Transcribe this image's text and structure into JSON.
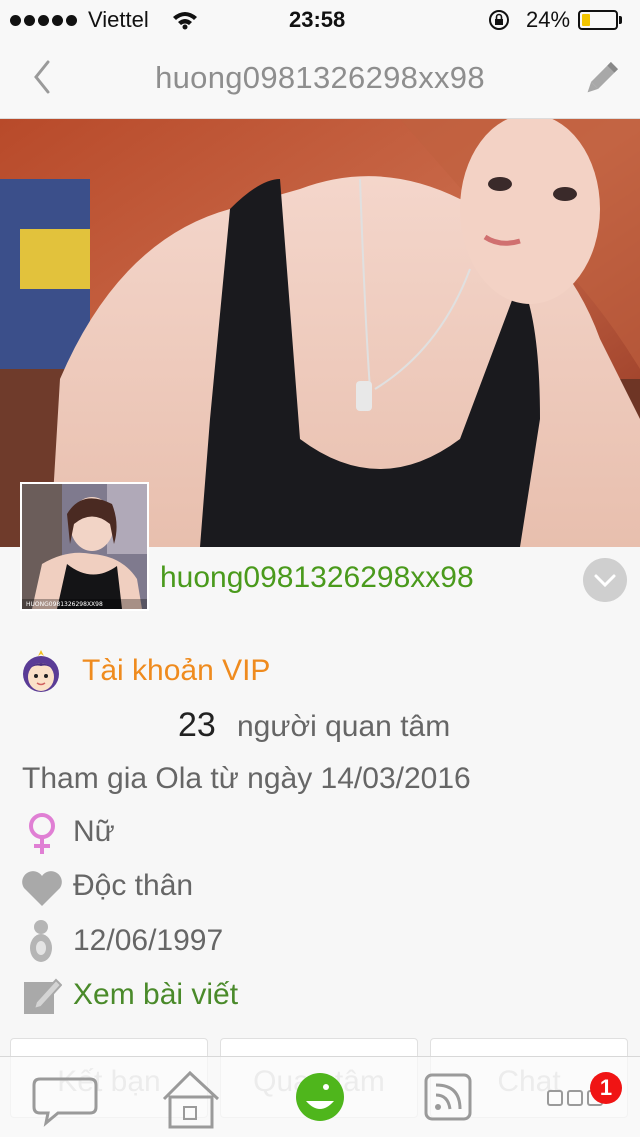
{
  "status_bar": {
    "carrier": "Viettel",
    "time": "23:58",
    "battery": "24%",
    "battery_level": 0.24
  },
  "nav": {
    "title": "huong0981326298xx98"
  },
  "profile": {
    "name": "huong0981326298xx98",
    "vip_label": "Tài khoản VIP",
    "followers_count": "23",
    "followers_label": "người quan tâm",
    "joined": "Tham gia Ola từ ngày 14/03/2016",
    "gender": "Nữ",
    "relationship": "Độc thân",
    "birthday": "12/06/1997",
    "posts_link": "Xem bài viết",
    "avatar_caption": "HUONG0981326298XX98"
  },
  "actions": {
    "add_friend": "Kết bạn",
    "follow": "Quan tâm",
    "chat": "Chat"
  },
  "tab_bar": {
    "badge_count": "1"
  },
  "colors": {
    "green": "#4a9a1c",
    "vip_orange": "#ef8b1e",
    "badge_red": "#f01414"
  }
}
